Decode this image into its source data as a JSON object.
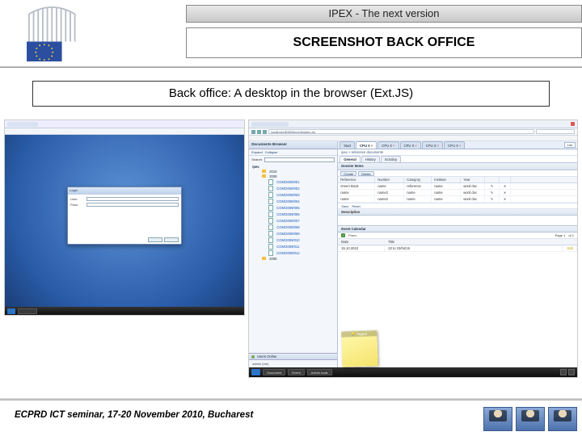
{
  "header": {
    "bar1": "IPEX - The next version",
    "bar2": "SCREENSHOT BACK OFFICE"
  },
  "subtitle": "Back office: A desktop in the browser (Ext.JS)",
  "footer": "ECPRD ICT seminar, 17-20 November 2010, Bucharest",
  "sc1": {
    "login_title": "Login",
    "user_label": "User:",
    "pass_label": "Pass:"
  },
  "sc2": {
    "url": "localhost:8080/bico/desktop.do",
    "tree_header": "Documents Browser",
    "tree_tool_expand": "Expand",
    "tree_tool_collapse": "Collapse",
    "search_label": "Search:",
    "tree_root": "ipex",
    "tree_years": [
      "2010",
      "2009",
      "2008"
    ],
    "tree_docs": [
      "COM/2009/001",
      "COM/2009/002",
      "COM/2009/003",
      "COM/2009/004",
      "COM/2009/005",
      "COM/2009/006",
      "COM/2009/007",
      "COM/2009/008",
      "COM/2009/009",
      "COM/2009/010",
      "COM/2009/011",
      "COM/2009/012"
    ],
    "subheader_users": "Users Online",
    "user_me": "admin (me)",
    "tabs_select": "List",
    "tabs": [
      "Start",
      "CPU X",
      "CPU X",
      "CPU X",
      "CPU X",
      "CPU X"
    ],
    "breadcrumb": "ipex > reference documents",
    "inner_tabs": [
      "General",
      "History",
      "Scrutiny"
    ],
    "grid_title": "Dossier Items",
    "grid_btn_create": "Create",
    "grid_btn_delete": "Delete",
    "grid_cols": [
      "Reference",
      "Number",
      "Category",
      "Institute",
      "Year",
      "",
      ""
    ],
    "grid_rows": [
      [
        "Green Book",
        "name",
        "reference",
        "name",
        "word doc",
        "✎",
        "✕"
      ],
      [
        "name",
        "name2",
        "name",
        "name",
        "word doc",
        "✎",
        "✕"
      ],
      [
        "name",
        "name2",
        "name",
        "name",
        "word doc",
        "✎",
        "✕"
      ]
    ],
    "tool_save": "Save",
    "tool_reset": "Reset",
    "desc_title": "Description",
    "cal_title": "Event Calendar",
    "cal_from": "From:",
    "cal_page": "Page 1",
    "cal_of": "of 1",
    "cal_cols": [
      "Date",
      "Title",
      ""
    ],
    "cal_rows": [
      [
        "15.10.2010",
        "23 to 23/04/15",
        "Edit"
      ]
    ],
    "note_title": "Tagged",
    "taskbar": [
      "Document",
      "Event",
      "Admin tools"
    ]
  }
}
